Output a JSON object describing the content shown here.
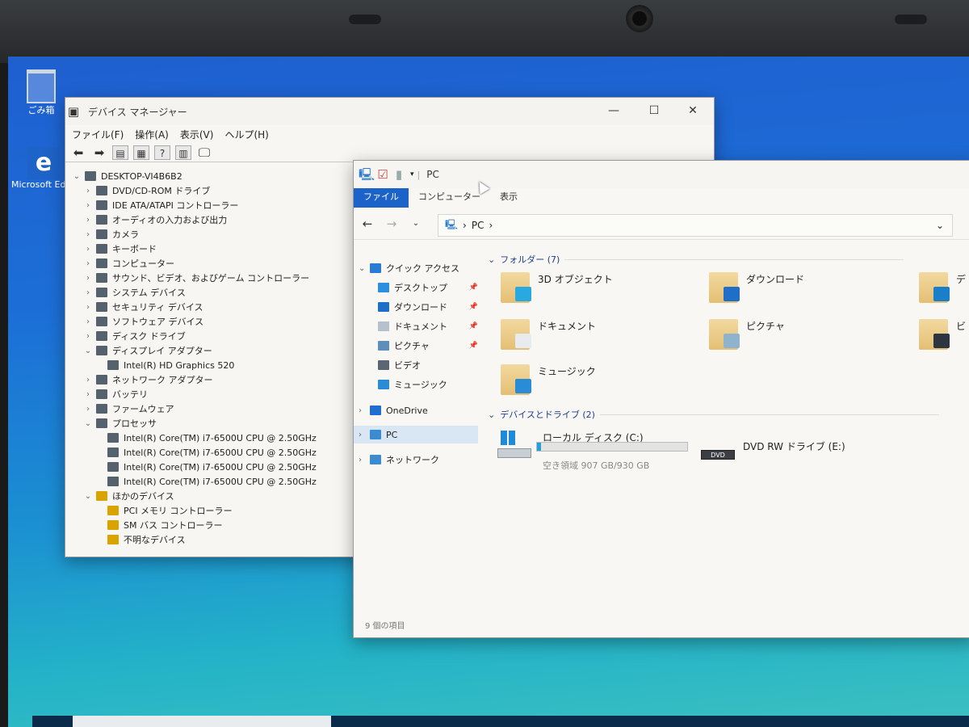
{
  "desktop": {
    "icons": [
      {
        "label": "ごみ箱",
        "icon": "recycle-bin-icon"
      },
      {
        "label": "Microsoft Edge",
        "icon": "edge-icon"
      }
    ]
  },
  "device_manager": {
    "title": "デバイス マネージャー",
    "menu": [
      "ファイル(F)",
      "操作(A)",
      "表示(V)",
      "ヘルプ(H)"
    ],
    "tree": [
      {
        "label": "DESKTOP-VI4B6B2",
        "level": 0,
        "expanded": true
      },
      {
        "label": "DVD/CD-ROM ドライブ",
        "level": 1
      },
      {
        "label": "IDE ATA/ATAPI コントローラー",
        "level": 1
      },
      {
        "label": "オーディオの入力および出力",
        "level": 1
      },
      {
        "label": "カメラ",
        "level": 1
      },
      {
        "label": "キーボード",
        "level": 1
      },
      {
        "label": "コンピューター",
        "level": 1
      },
      {
        "label": "サウンド、ビデオ、およびゲーム コントローラー",
        "level": 1
      },
      {
        "label": "システム デバイス",
        "level": 1
      },
      {
        "label": "セキュリティ デバイス",
        "level": 1
      },
      {
        "label": "ソフトウェア デバイス",
        "level": 1
      },
      {
        "label": "ディスク ドライブ",
        "level": 1
      },
      {
        "label": "ディスプレイ アダプター",
        "level": 1,
        "expanded": true
      },
      {
        "label": "Intel(R) HD Graphics 520",
        "level": 2
      },
      {
        "label": "ネットワーク アダプター",
        "level": 1
      },
      {
        "label": "バッテリ",
        "level": 1
      },
      {
        "label": "ファームウェア",
        "level": 1
      },
      {
        "label": "プロセッサ",
        "level": 1,
        "expanded": true
      },
      {
        "label": "Intel(R) Core(TM) i7-6500U CPU @ 2.50GHz",
        "level": 2
      },
      {
        "label": "Intel(R) Core(TM) i7-6500U CPU @ 2.50GHz",
        "level": 2
      },
      {
        "label": "Intel(R) Core(TM) i7-6500U CPU @ 2.50GHz",
        "level": 2
      },
      {
        "label": "Intel(R) Core(TM) i7-6500U CPU @ 2.50GHz",
        "level": 2
      },
      {
        "label": "ほかのデバイス",
        "level": 1,
        "expanded": true,
        "warn": true
      },
      {
        "label": "PCI メモリ コントローラー",
        "level": 2,
        "warn": true
      },
      {
        "label": "SM バス コントローラー",
        "level": 2,
        "warn": true
      },
      {
        "label": "不明なデバイス",
        "level": 2,
        "warn": true
      }
    ]
  },
  "explorer": {
    "title": "PC",
    "ribbon_tabs": [
      "ファイル",
      "コンピューター",
      "表示"
    ],
    "address": "PC",
    "nav": [
      {
        "label": "クイック アクセス",
        "icon": "star-icon",
        "color": "#2a7bd4",
        "level": 0
      },
      {
        "label": "デスクトップ",
        "icon": "desktop-icon",
        "color": "#2d8fe0",
        "level": 1,
        "pinned": true
      },
      {
        "label": "ダウンロード",
        "icon": "download-icon",
        "color": "#1f6fc9",
        "level": 1,
        "pinned": true
      },
      {
        "label": "ドキュメント",
        "icon": "document-icon",
        "color": "#b7c1cb",
        "level": 1,
        "pinned": true
      },
      {
        "label": "ピクチャ",
        "icon": "picture-icon",
        "color": "#5d8fb8",
        "level": 1,
        "pinned": true
      },
      {
        "label": "ビデオ",
        "icon": "video-icon",
        "color": "#5b6670",
        "level": 1
      },
      {
        "label": "ミュージック",
        "icon": "music-icon",
        "color": "#2a8bd6",
        "level": 1
      },
      {
        "label": "OneDrive",
        "icon": "cloud-icon",
        "color": "#1e6fd0",
        "level": 0
      },
      {
        "label": "PC",
        "icon": "pc-icon",
        "color": "#3a8bd0",
        "level": 0,
        "selected": true
      },
      {
        "label": "ネットワーク",
        "icon": "network-icon",
        "color": "#3a8bd0",
        "level": 0
      }
    ],
    "folders_group": "フォルダー (7)",
    "folders": [
      {
        "label": "3D オブジェクト",
        "badge": "#2aa9e0"
      },
      {
        "label": "ダウンロード",
        "badge": "#1f6fc9"
      },
      {
        "label": "デ",
        "badge": "#1a7fc8"
      },
      {
        "label": "ドキュメント",
        "badge": "#e8ecef"
      },
      {
        "label": "ピクチャ",
        "badge": "#8fb3cc"
      },
      {
        "label": "ビ",
        "badge": "#2d3640"
      },
      {
        "label": "ミュージック",
        "badge": "#2a8bd6"
      }
    ],
    "devices_group": "デバイスとドライブ (2)",
    "drives": [
      {
        "label": "ローカル ディスク (C:)",
        "free": "空き領域 907 GB/930 GB",
        "used_fraction": 0.025
      },
      {
        "label": "DVD RW ドライブ (E:)",
        "media": "DVD"
      }
    ],
    "status": "9 個の項目"
  }
}
